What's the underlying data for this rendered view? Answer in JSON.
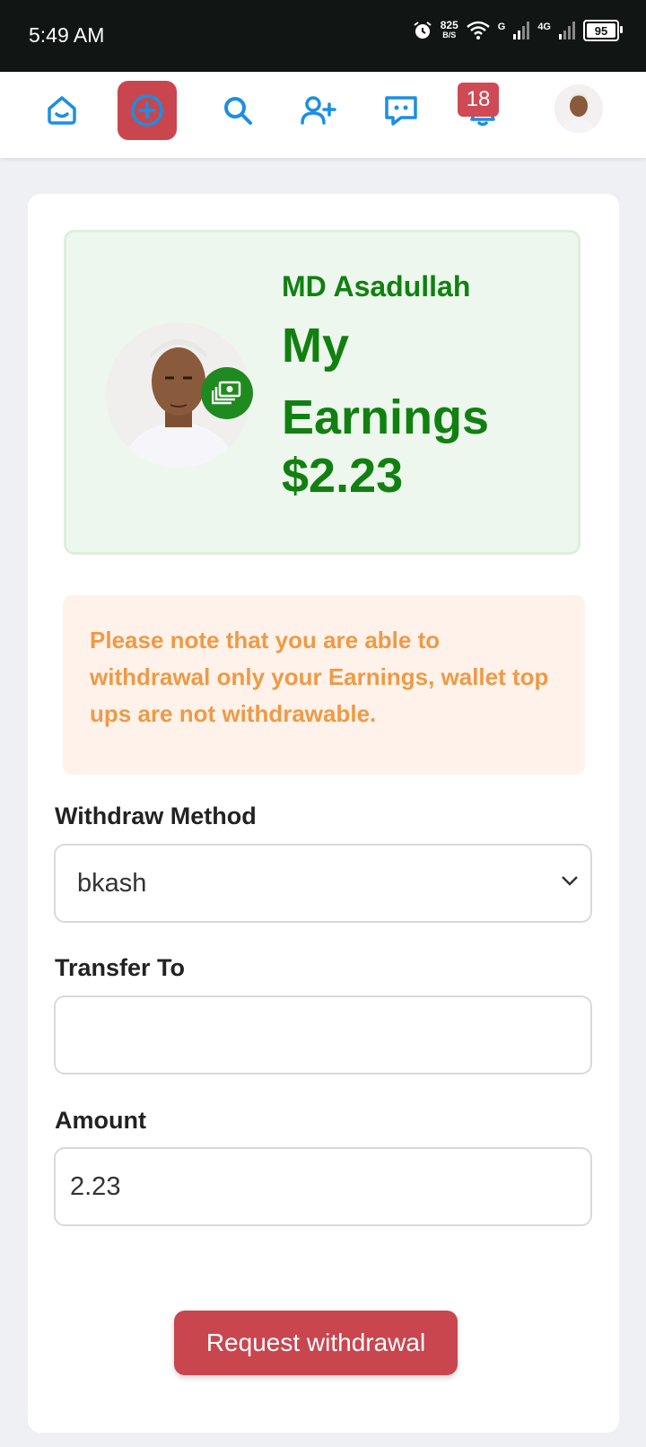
{
  "status_bar": {
    "time": "5:49 AM",
    "net_speed": "825",
    "net_unit": "B/S",
    "signal_1": "G",
    "signal_2": "4G",
    "battery": "95"
  },
  "nav": {
    "notification_count": "18",
    "icons": [
      "home-icon",
      "add-icon",
      "search-icon",
      "add-friend-icon",
      "messages-icon",
      "notifications-icon",
      "profile-avatar"
    ]
  },
  "earnings": {
    "name": "MD Asadullah",
    "title": "My Earnings",
    "amount": "$2.23"
  },
  "note": "Please note that you are able to withdrawal only your Earnings, wallet top ups are not withdrawable.",
  "form": {
    "method_label": "Withdraw Method",
    "method_value": "bkash",
    "transfer_label": "Transfer To",
    "transfer_value": "",
    "amount_label": "Amount",
    "amount_value": "2.23",
    "submit_label": "Request withdrawal"
  },
  "colors": {
    "accent": "#c9464f",
    "earnings_green": "#118011",
    "note_orange": "#ef9a45",
    "nav_blue": "#1a8fe3"
  }
}
